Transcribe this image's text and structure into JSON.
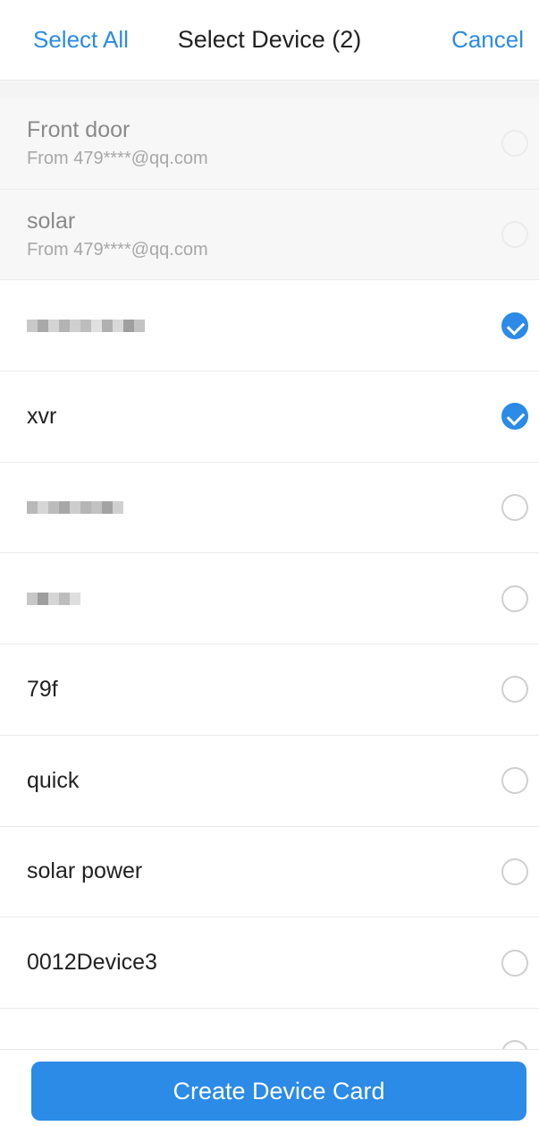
{
  "header": {
    "select_all_label": "Select All",
    "title": "Select Device (2)",
    "cancel_label": "Cancel"
  },
  "devices": [
    {
      "name": "Front door",
      "from": "From 479****@qq.com",
      "shared": true,
      "checked": false,
      "blurred": false
    },
    {
      "name": "solar",
      "from": "From 479****@qq.com",
      "shared": true,
      "checked": false,
      "blurred": false
    },
    {
      "name": "",
      "from": "",
      "shared": false,
      "checked": true,
      "blurred": true
    },
    {
      "name": "xvr",
      "from": "",
      "shared": false,
      "checked": true,
      "blurred": false
    },
    {
      "name": "",
      "from": "",
      "shared": false,
      "checked": false,
      "blurred": true
    },
    {
      "name": "",
      "from": "",
      "shared": false,
      "checked": false,
      "blurred": true
    },
    {
      "name": "79f",
      "from": "",
      "shared": false,
      "checked": false,
      "blurred": false
    },
    {
      "name": "quick",
      "from": "",
      "shared": false,
      "checked": false,
      "blurred": false
    },
    {
      "name": "solar power",
      "from": "",
      "shared": false,
      "checked": false,
      "blurred": false
    },
    {
      "name": "0012Device3",
      "from": "",
      "shared": false,
      "checked": false,
      "blurred": false
    }
  ],
  "footer": {
    "create_label": "Create Device Card"
  },
  "colors": {
    "accent": "#2b8be6",
    "shared_bg": "#f7f7f7"
  }
}
